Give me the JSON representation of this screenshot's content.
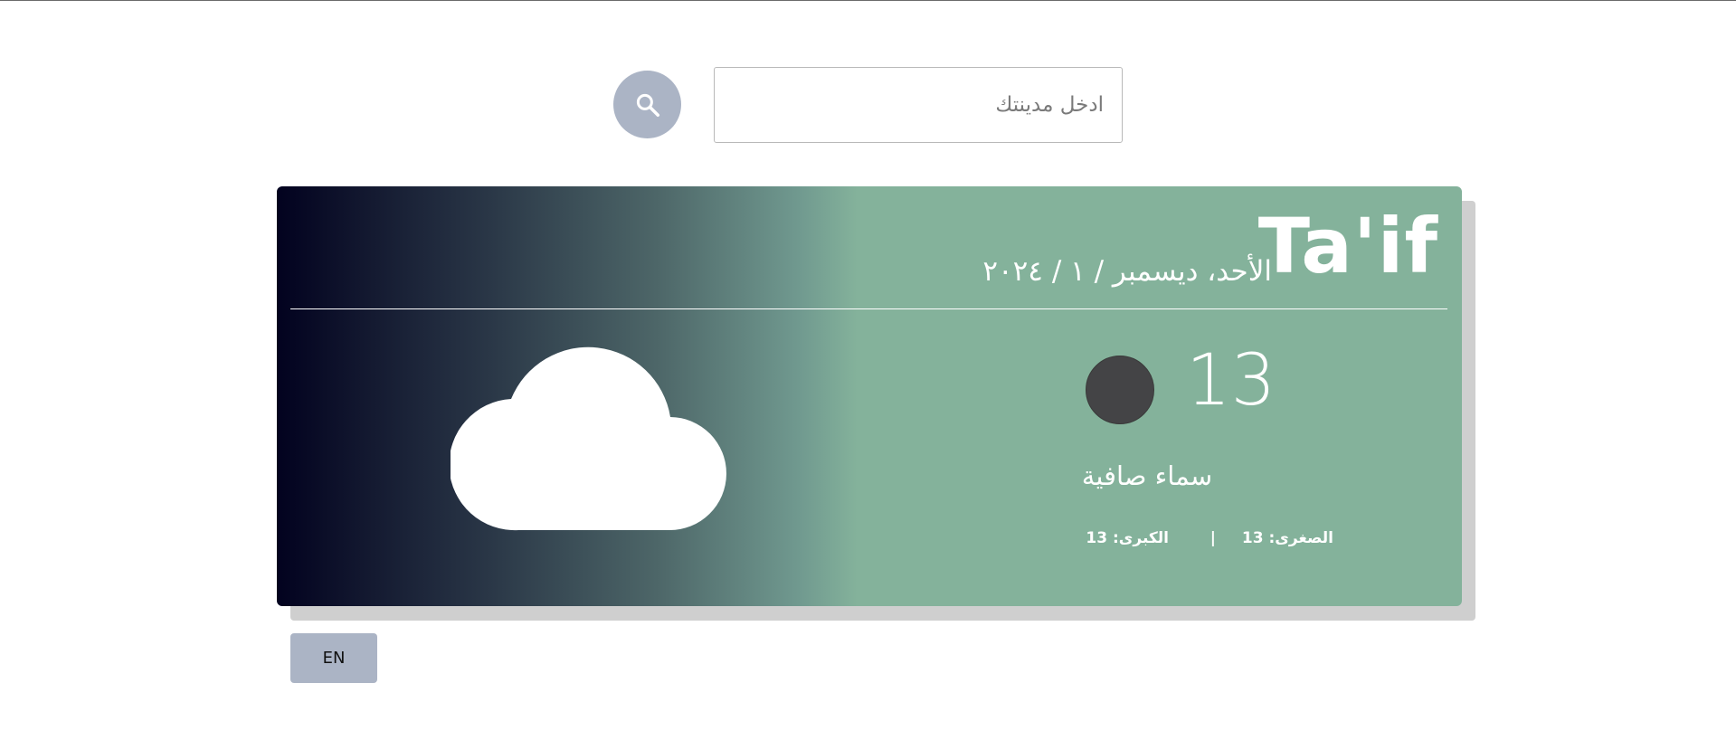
{
  "search": {
    "placeholder": "ادخل مدينتك",
    "value": ""
  },
  "weather": {
    "city": "Ta'if",
    "date": "الأحد، ديسمبر / ١ / ٢٠٢٤",
    "temperature": "13",
    "description": "سماء صافية",
    "min_label": "الصغرى: 13",
    "separator": "|",
    "max_label": "الكبرى: 13",
    "icon": "cloud-icon"
  },
  "language_button": {
    "label": "EN"
  },
  "colors": {
    "search_button": "#abb4c5",
    "card_gradient_start": "#02021f",
    "card_gradient_end": "#84b29b",
    "status_dot": "#444446",
    "text_on_card": "#ffffff",
    "language_button": "#abb4c5"
  },
  "icons": {
    "search_button_icon": "search-icon",
    "weather_icon": "cloud-icon"
  }
}
